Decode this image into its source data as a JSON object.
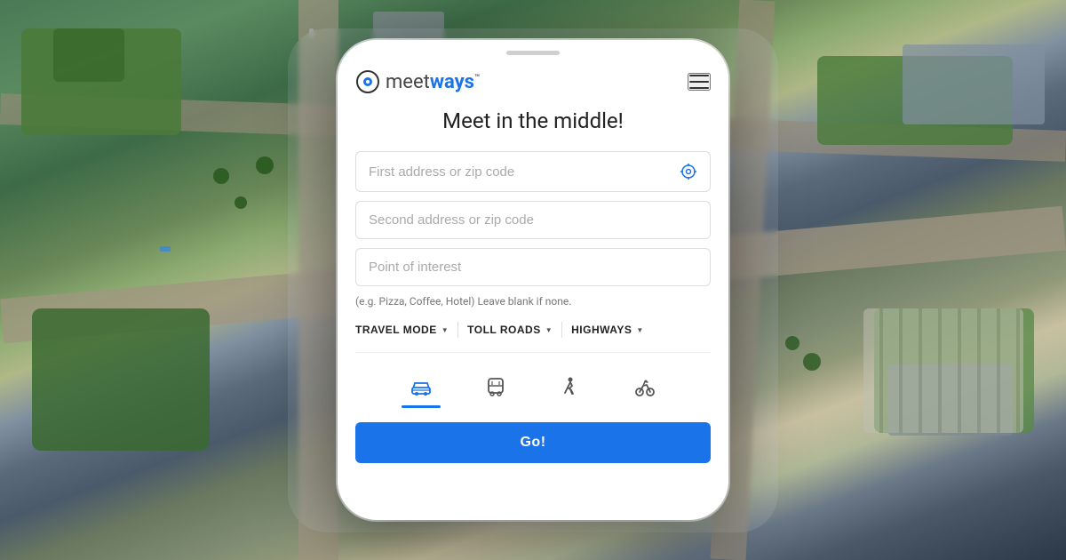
{
  "background": {
    "description": "Aerial view of city roads and buildings"
  },
  "app": {
    "logo": {
      "meet": "meet",
      "ways": "ways",
      "tm": "™"
    },
    "tagline": "Meet in the middle!",
    "inputs": {
      "first_placeholder": "First address or zip code",
      "second_placeholder": "Second address or zip code",
      "poi_placeholder": "Point of interest"
    },
    "hint": "(e.g. Pizza, Coffee, Hotel) Leave blank if none.",
    "controls": {
      "travel_mode": "TRAVEL MODE",
      "toll_roads": "TOLL ROADS",
      "highways": "HIGHWAYS"
    },
    "go_button": "Go!",
    "transport_modes": [
      "car",
      "transit",
      "walk",
      "bike"
    ],
    "active_mode": "car"
  },
  "colors": {
    "primary": "#1a73e8",
    "text_dark": "#222222",
    "text_medium": "#666666",
    "text_light": "#aaaaaa",
    "border": "#dddddd",
    "hint": "#777777"
  }
}
